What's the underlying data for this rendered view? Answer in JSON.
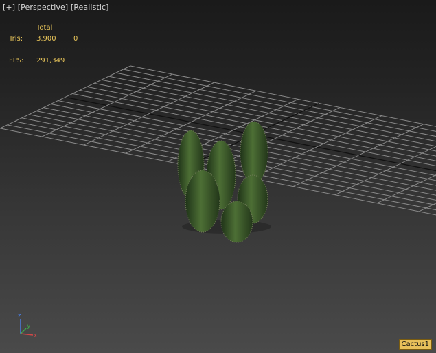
{
  "viewport": {
    "menu": {
      "plus": "[+]",
      "view": "[Perspective]",
      "shading": "[Realistic]"
    },
    "stats": {
      "total_header": "Total",
      "tris_label": "Tris:",
      "tris_value": "3.900",
      "tris_selected": "0",
      "fps_label": "FPS:",
      "fps_value": "291,349"
    },
    "axis_labels": {
      "x": "x",
      "y": "y",
      "z": "z"
    },
    "object_label": "Cactus1"
  },
  "colors": {
    "stats_text": "#e8c55a",
    "grid_line": "#8a8a8a",
    "grid_main_axis": "#111111",
    "cactus_green": "#3f5e2c",
    "label_bg": "#e7c05a"
  }
}
